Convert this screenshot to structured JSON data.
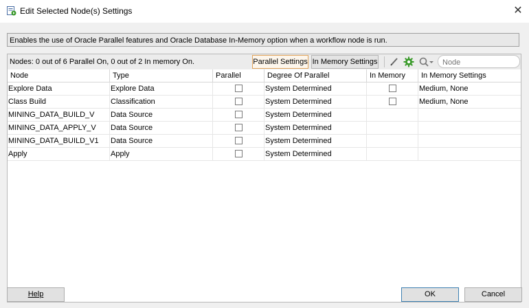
{
  "window": {
    "title": "Edit Selected Node(s) Settings",
    "close_glyph": "✕"
  },
  "info": {
    "text": "Enables the use of Oracle Parallel features and Oracle Database In-Memory option when a workflow node is run."
  },
  "toolbar": {
    "nodes_status": "Nodes: 0 out of 6 Parallel On, 0 out of 2 In memory On.",
    "parallel_settings_label": "Parallel Settings",
    "in_memory_settings_label": "In Memory Settings",
    "search_placeholder": "Node"
  },
  "table": {
    "columns": [
      "Node",
      "Type",
      "Parallel",
      "Degree Of Parallel",
      "In Memory",
      "In Memory Settings"
    ],
    "rows": [
      {
        "node": "Explore Data",
        "type": "Explore Data",
        "parallel": false,
        "degree": "System Determined",
        "in_memory": false,
        "in_memory_settings": "Medium, None"
      },
      {
        "node": "Class Build",
        "type": "Classification",
        "parallel": false,
        "degree": "System Determined",
        "in_memory": false,
        "in_memory_settings": "Medium, None"
      },
      {
        "node": "MINING_DATA_BUILD_V",
        "type": "Data Source",
        "parallel": false,
        "degree": "System Determined",
        "in_memory": null,
        "in_memory_settings": ""
      },
      {
        "node": "MINING_DATA_APPLY_V",
        "type": "Data Source",
        "parallel": false,
        "degree": "System Determined",
        "in_memory": null,
        "in_memory_settings": ""
      },
      {
        "node": "MINING_DATA_BUILD_V1",
        "type": "Data Source",
        "parallel": false,
        "degree": "System Determined",
        "in_memory": null,
        "in_memory_settings": ""
      },
      {
        "node": "Apply",
        "type": "Apply",
        "parallel": false,
        "degree": "System Determined",
        "in_memory": null,
        "in_memory_settings": ""
      }
    ]
  },
  "buttons": {
    "help": "Help",
    "ok": "OK",
    "cancel": "Cancel"
  },
  "icons": {
    "app": "workflow-settings-icon",
    "edit": "pencil-icon",
    "settings": "gear-icon",
    "search": "search-icon"
  },
  "colors": {
    "active_tab_border": "#e0a25a",
    "settings_icon_green": "#3a9a2a",
    "default_button_border": "#3c7fb1"
  }
}
